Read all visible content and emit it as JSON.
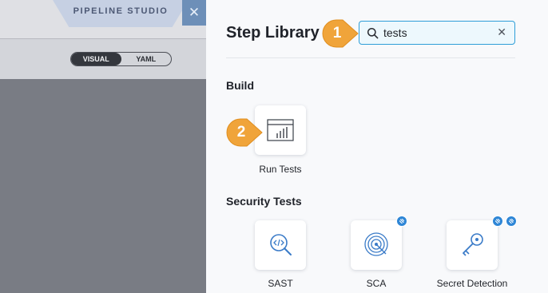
{
  "background": {
    "studio_tab": "PIPELINE STUDIO",
    "view_toggle": [
      "VISUAL",
      "YAML"
    ],
    "close_icon": "close-icon"
  },
  "drawer": {
    "title": "Step Library",
    "search": {
      "value": "tests",
      "icon": "search-icon",
      "clear_icon": "clear-icon"
    },
    "sections": [
      {
        "title": "Build",
        "steps": [
          {
            "label": "Run Tests",
            "icon": "run-tests-icon"
          }
        ]
      },
      {
        "title": "Security Tests",
        "steps": [
          {
            "label": "SAST",
            "icon": "sast-icon"
          },
          {
            "label": "SCA",
            "icon": "sca-icon"
          },
          {
            "label": "Secret Detection",
            "icon": "secret-detection-icon"
          }
        ]
      }
    ]
  },
  "callouts": [
    "1",
    "2"
  ],
  "colors": {
    "accent": "#2f9ed8",
    "callout": "#f0a43a",
    "badge": "#2e86d6"
  }
}
